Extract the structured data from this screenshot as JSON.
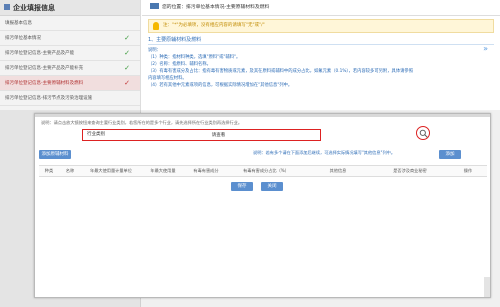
{
  "sidebar": {
    "title": "企业填报信息",
    "items": [
      {
        "label": "填报基本信息",
        "status": "",
        "active": false
      },
      {
        "label": "排污单位基本情况",
        "status": "✓",
        "active": false
      },
      {
        "label": "排污单位登记信息-主要产品及产能",
        "status": "✓",
        "active": false
      },
      {
        "label": "排污单位登记信息-主要产品及产能补充",
        "status": "✓",
        "active": false
      },
      {
        "label": "排污单位登记信息-主要原辅材料及燃料",
        "status": "✓",
        "active": true
      },
      {
        "label": "排污单位登记信息-排污节点及污染治理设施",
        "status": "",
        "active": false
      }
    ]
  },
  "breadcrumb": "您的位置：排污单位基本情况-主要原辅材料及燃料",
  "tip": "注：\"*\"为必填项，没有相应内容的请填写\"无\"或\"/\"",
  "section_title": "1、主要原辅材料及燃料",
  "notes": [
    "说明：",
    "（1）种类：指材料种类，选填\"原料\"或\"辅料\"。",
    "（2）名称：指原料、辅料名称。",
    "（3）有毒有害成分及占比：指有毒有害物质或元素，及其在原料或辅料中的成分占比，如氟元素（0.1%），若内容较多可另附，具体请参照",
    "    内容填写相应材料。",
    "（4）若有其他中元素或项的信息，可根据实际情况增加在\"其他信息\"列中。"
  ],
  "modal": {
    "description": "说明：请点击放大镜按钮来查询主要行业类别，若您所在的是多个行业，请先选择所在行业类别再选择行业。",
    "search": {
      "label": "行业类别",
      "value": "请查看",
      "button_icon": "magnifier-icon"
    },
    "add_button": "添加原辅材料",
    "hint": "说明：若有多个请在下面添加后继续，可选择实际情况填写\"其他信息\"列中。",
    "submit_button": "添加",
    "columns": [
      "种类",
      "名称",
      "年最大使用量计量单位",
      "年最大使用量",
      "有毒有害成分",
      "有毒有害成分占比（%）",
      "其他信息",
      "是否涉及商业秘密",
      "操作"
    ],
    "save_button": "保存",
    "close_button": "关闭"
  },
  "colors": {
    "accent": "#5b8fcf",
    "highlight": "#dd2222",
    "title_blue": "#2a6ab5"
  }
}
